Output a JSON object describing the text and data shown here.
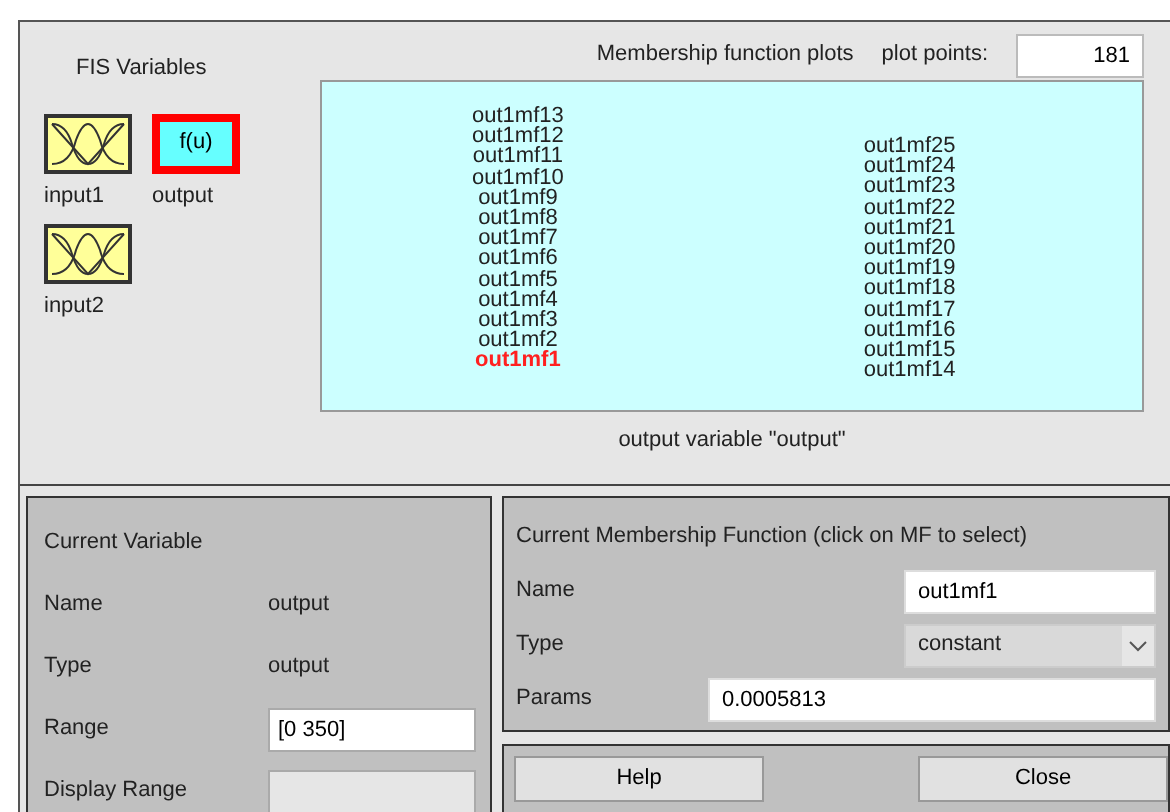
{
  "fis_variables": {
    "title": "FIS Variables",
    "items": [
      {
        "label": "input1",
        "kind": "input",
        "selected": false
      },
      {
        "label": "output",
        "kind": "output",
        "icon_text": "f(u)",
        "selected": true
      },
      {
        "label": "input2",
        "kind": "input",
        "selected": false
      }
    ]
  },
  "plot": {
    "title": "Membership function plots",
    "points_label": "plot points:",
    "points_value": "181",
    "caption": "output variable \"output\"",
    "left_column": [
      {
        "label": "out1mf13",
        "selected": false
      },
      {
        "label": "out1mf12",
        "selected": false
      },
      {
        "label": "out1mf11",
        "selected": false
      },
      {
        "label": "out1mf10",
        "selected": false
      },
      {
        "label": "out1mf9",
        "selected": false
      },
      {
        "label": "out1mf8",
        "selected": false
      },
      {
        "label": "out1mf7",
        "selected": false
      },
      {
        "label": "out1mf6",
        "selected": false
      },
      {
        "label": "out1mf5",
        "selected": false
      },
      {
        "label": "out1mf4",
        "selected": false
      },
      {
        "label": "out1mf3",
        "selected": false
      },
      {
        "label": "out1mf2",
        "selected": false
      },
      {
        "label": "out1mf1",
        "selected": true
      }
    ],
    "right_column": [
      {
        "label": "out1mf25",
        "selected": false
      },
      {
        "label": "out1mf24",
        "selected": false
      },
      {
        "label": "out1mf23",
        "selected": false
      },
      {
        "label": "out1mf22",
        "selected": false
      },
      {
        "label": "out1mf21",
        "selected": false
      },
      {
        "label": "out1mf20",
        "selected": false
      },
      {
        "label": "out1mf19",
        "selected": false
      },
      {
        "label": "out1mf18",
        "selected": false
      },
      {
        "label": "out1mf17",
        "selected": false
      },
      {
        "label": "out1mf16",
        "selected": false
      },
      {
        "label": "out1mf15",
        "selected": false
      },
      {
        "label": "out1mf14",
        "selected": false
      }
    ]
  },
  "current_variable": {
    "title": "Current Variable",
    "name_label": "Name",
    "name_value": "output",
    "type_label": "Type",
    "type_value": "output",
    "range_label": "Range",
    "range_value": "[0 350]",
    "display_range_label": "Display Range",
    "display_range_disabled": true
  },
  "current_mf": {
    "title": "Current Membership Function (click on MF to select)",
    "name_label": "Name",
    "name_value": "out1mf1",
    "type_label": "Type",
    "type_value": "constant",
    "params_label": "Params",
    "params_value": "0.0005813"
  },
  "buttons": [
    "Help",
    "Close"
  ]
}
